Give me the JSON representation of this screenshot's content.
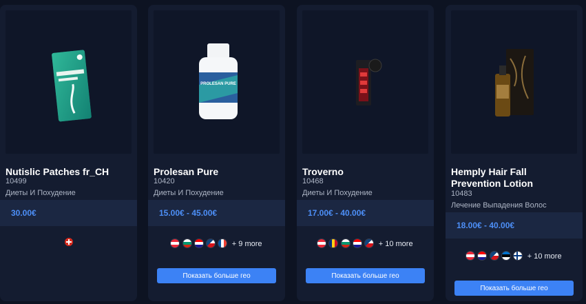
{
  "products": [
    {
      "name": "Nutislic Patches fr_CH",
      "id": "10499",
      "category": "Диеты И Похудение",
      "price": "30.00€",
      "flags": [
        "ch-flag"
      ],
      "more": "",
      "button": ""
    },
    {
      "name": "Prolesan Pure",
      "id": "10420",
      "category": "Диеты И Похудение",
      "price": "15.00€ - 45.00€",
      "flags": [
        "at-flag",
        "bg-flag",
        "hr-flag",
        "cz-flag",
        "fr-flag"
      ],
      "more": "+ 9 more",
      "button": "Показать больше гео",
      "image_label": "PROLESAN PURE"
    },
    {
      "name": "Troverno",
      "id": "10468",
      "category": "Диеты И Похудение",
      "price": "17.00€ - 40.00€",
      "flags": [
        "at-flag",
        "ro-flag",
        "bg-flag",
        "hr-flag",
        "cz-flag"
      ],
      "more": "+ 10 more",
      "button": "Показать больше гео"
    },
    {
      "name": "Hemply Hair Fall Prevention Lotion",
      "id": "10483",
      "category": "Лечение Выпадения Волос",
      "price": "18.00€ - 40.00€",
      "flags": [
        "at-flag",
        "hr-flag",
        "cz-flag",
        "ee-flag",
        "fi-flag"
      ],
      "more": "+ 10 more",
      "button": "Показать больше гео"
    }
  ],
  "colors": {
    "page_bg": "#0d1322",
    "card_bg": "#141c30",
    "price_band": "#1b2742",
    "price_text": "#4d8ff7",
    "button_bg": "#3c82f5"
  }
}
